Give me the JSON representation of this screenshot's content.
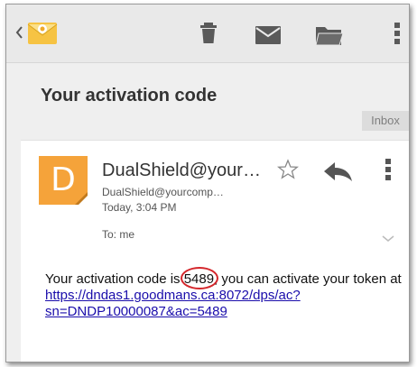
{
  "toolbar": {
    "icons": [
      "back-arrow-icon",
      "app-logo-icon",
      "delete-icon",
      "mark-unread-icon",
      "move-to-folder-icon",
      "more-options-icon"
    ]
  },
  "message": {
    "subject": "Your activation code",
    "label": "Inbox",
    "sender": {
      "avatar_letter": "D",
      "name": "DualShield@your…",
      "email": "DualShield@yourcomp…"
    },
    "date": "Today, 3:04 PM",
    "recipient": "To: me",
    "body": {
      "prefix": "Your activation code is ",
      "code": "5489",
      "suffix": ", you can activate your token at",
      "link_line1": "https://dndas1.goodmans.ca:8072/dps/ac?",
      "link_line2": "sn=DNDP10000087&ac=5489"
    }
  },
  "colors": {
    "avatar": "#f5a33a",
    "highlight": "#d4262b",
    "link": "#1a0dab",
    "toolbar_bg": "#e9e9e9"
  }
}
